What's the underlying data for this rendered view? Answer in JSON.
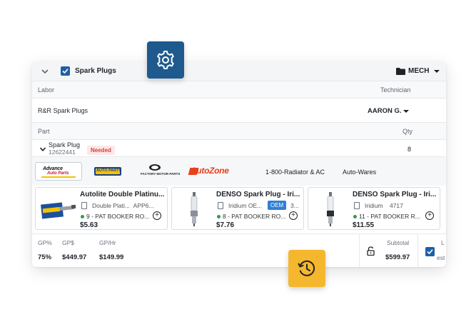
{
  "job": {
    "title": "Spark Plugs",
    "category": "MECH"
  },
  "labor": {
    "header_label": "Labor",
    "technician_label": "Technician",
    "description": "R&R Spark Plugs",
    "technician": "AARON G."
  },
  "part": {
    "header_label": "Part",
    "qty_label": "Qty",
    "name": "Spark Plug",
    "number": "12622441",
    "status": "Needed",
    "qty": "8"
  },
  "vendors": {
    "advance": "Advance Auto Parts",
    "napa": "NAPA AUTO PARTS",
    "factory": "FACTORY MOTOR PARTS",
    "autozone": "AutoZone",
    "radiator": "1-800-Radiator & AC",
    "autowares": "Auto-Wares"
  },
  "products": [
    {
      "name": "Autolite Double Platinu...",
      "brand": "Double Plati...",
      "sku": "APP6...",
      "location": "9 - PAT BOOKER RO...",
      "price": "$5.63"
    },
    {
      "name": "DENSO Spark Plug - Iri...",
      "brand": "Iridium OE...",
      "badge": "OEM",
      "sku": "3...",
      "location": "8 - PAT BOOKER RO...",
      "price": "$7.76"
    },
    {
      "name": "DENSO Spark Plug - Iri...",
      "brand": "Iridium",
      "sku": "4717",
      "location": "11 - PAT BOOKER R...",
      "price": "$11.55"
    }
  ],
  "totals": {
    "gp_pct_label": "GP%",
    "gp_pct": "75%",
    "gp_label": "GP$",
    "gp": "$449.97",
    "gphr_label": "GP/Hr",
    "gphr": "$149.99",
    "subtotal_label": "Subtotal",
    "subtotal": "$599.97",
    "extra_label": "L",
    "extra_value": "est"
  },
  "colors": {
    "gear_button": "#1e5a8e",
    "history_button": "#f5b72d",
    "checkbox": "#1f5fa8",
    "needed_text": "#d0463f",
    "autozone": "#e8401c"
  },
  "icons": {
    "settings": "gear-icon",
    "history": "history-icon"
  }
}
